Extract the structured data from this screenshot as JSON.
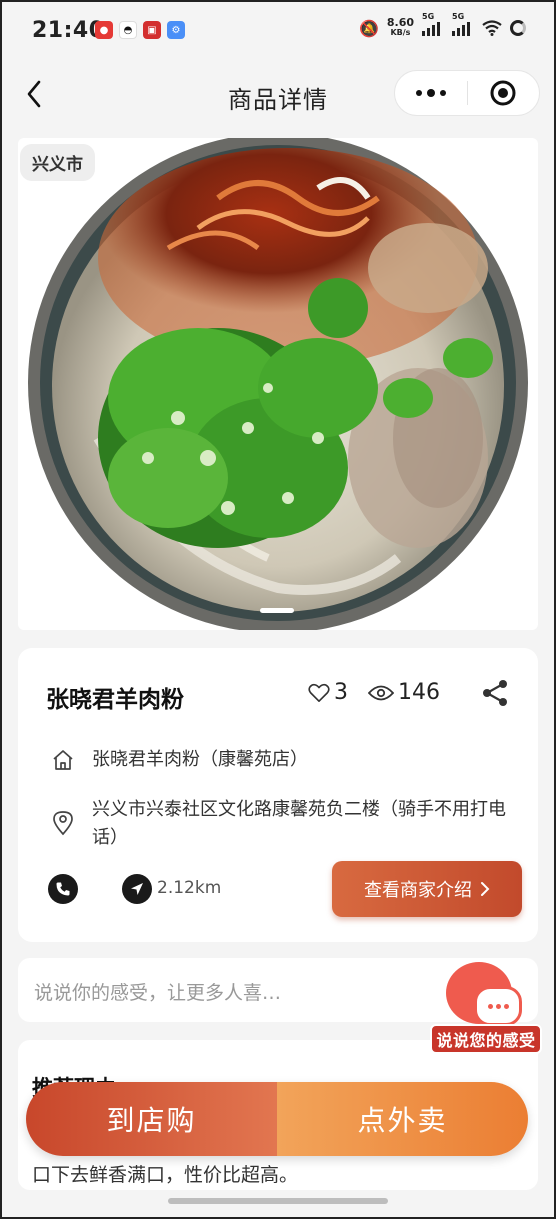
{
  "status_bar": {
    "time": "21:40",
    "net_speed_value": "8.60",
    "net_speed_unit": "KB/s",
    "signal_1": "5G",
    "signal_2": "5G"
  },
  "nav": {
    "title": "商品详情"
  },
  "hero": {
    "city_tag": "兴义市"
  },
  "shop": {
    "name": "张晓君羊肉粉",
    "likes": "3",
    "views": "146",
    "store_name": "张晓君羊肉粉（康馨苑店）",
    "address": "兴义市兴泰社区文化路康馨苑负二楼（骑手不用打电话）",
    "distance": "2.12km",
    "intro_button": "查看商家介绍"
  },
  "comment": {
    "placeholder": "说说你的感受，让更多人喜…",
    "badge_label": "说说您的感受"
  },
  "recommend": {
    "title": "推荐理由",
    "text": "口下去鲜香满口，性价比超高。"
  },
  "actions": {
    "store_buy": "到店购",
    "delivery": "点外卖"
  },
  "colors": {
    "accent": "#c8472b",
    "delivery": "#eb7e33",
    "badge_red": "#ef5b4e"
  }
}
